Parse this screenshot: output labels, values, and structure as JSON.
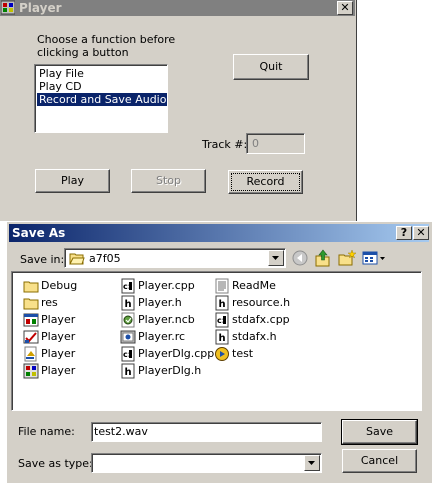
{
  "player": {
    "title": "Player",
    "close_glyph": "✕",
    "instructions": "Choose a function before clicking a button",
    "functions": [
      "Play File",
      "Play CD",
      "Record and Save Audio"
    ],
    "selected_function_index": 2,
    "quit_label": "Quit",
    "track_label": "Track #:",
    "track_value": "0",
    "play_label": "Play",
    "stop_label": "Stop",
    "record_label": "Record"
  },
  "save_as": {
    "title": "Save As",
    "help_glyph": "?",
    "close_glyph": "✕",
    "save_in_label": "Save in:",
    "save_in_value": "a7f05",
    "files": [
      {
        "name": "Debug",
        "icon": "folder-icon"
      },
      {
        "name": "res",
        "icon": "folder-icon"
      },
      {
        "name": "Player",
        "icon": "workspace-file-icon"
      },
      {
        "name": "Player",
        "icon": "project-file-icon"
      },
      {
        "name": "Player",
        "icon": "options-file-icon"
      },
      {
        "name": "Player",
        "icon": "application-icon"
      },
      {
        "name": "Player.cpp",
        "icon": "cpp-file-icon"
      },
      {
        "name": "Player.h",
        "icon": "header-file-icon"
      },
      {
        "name": "Player.ncb",
        "icon": "ncb-file-icon"
      },
      {
        "name": "Player.rc",
        "icon": "resource-script-icon"
      },
      {
        "name": "PlayerDlg.cpp",
        "icon": "cpp-file-icon"
      },
      {
        "name": "PlayerDlg.h",
        "icon": "header-file-icon"
      },
      {
        "name": "ReadMe",
        "icon": "text-file-icon"
      },
      {
        "name": "resource.h",
        "icon": "header-file-icon"
      },
      {
        "name": "stdafx.cpp",
        "icon": "cpp-file-icon"
      },
      {
        "name": "stdafx.h",
        "icon": "header-file-icon"
      },
      {
        "name": "test",
        "icon": "media-file-icon"
      }
    ],
    "file_name_label": "File name:",
    "file_name_value": "test2.wav",
    "save_as_type_label": "Save as type:",
    "save_as_type_value": "",
    "save_label": "Save",
    "cancel_label": "Cancel"
  },
  "colors": {
    "window_face": "#d4d0c8",
    "active_title_start": "#0a246a",
    "active_title_end": "#a6caf0",
    "inactive_title": "#808080",
    "selection": "#0a246a"
  }
}
